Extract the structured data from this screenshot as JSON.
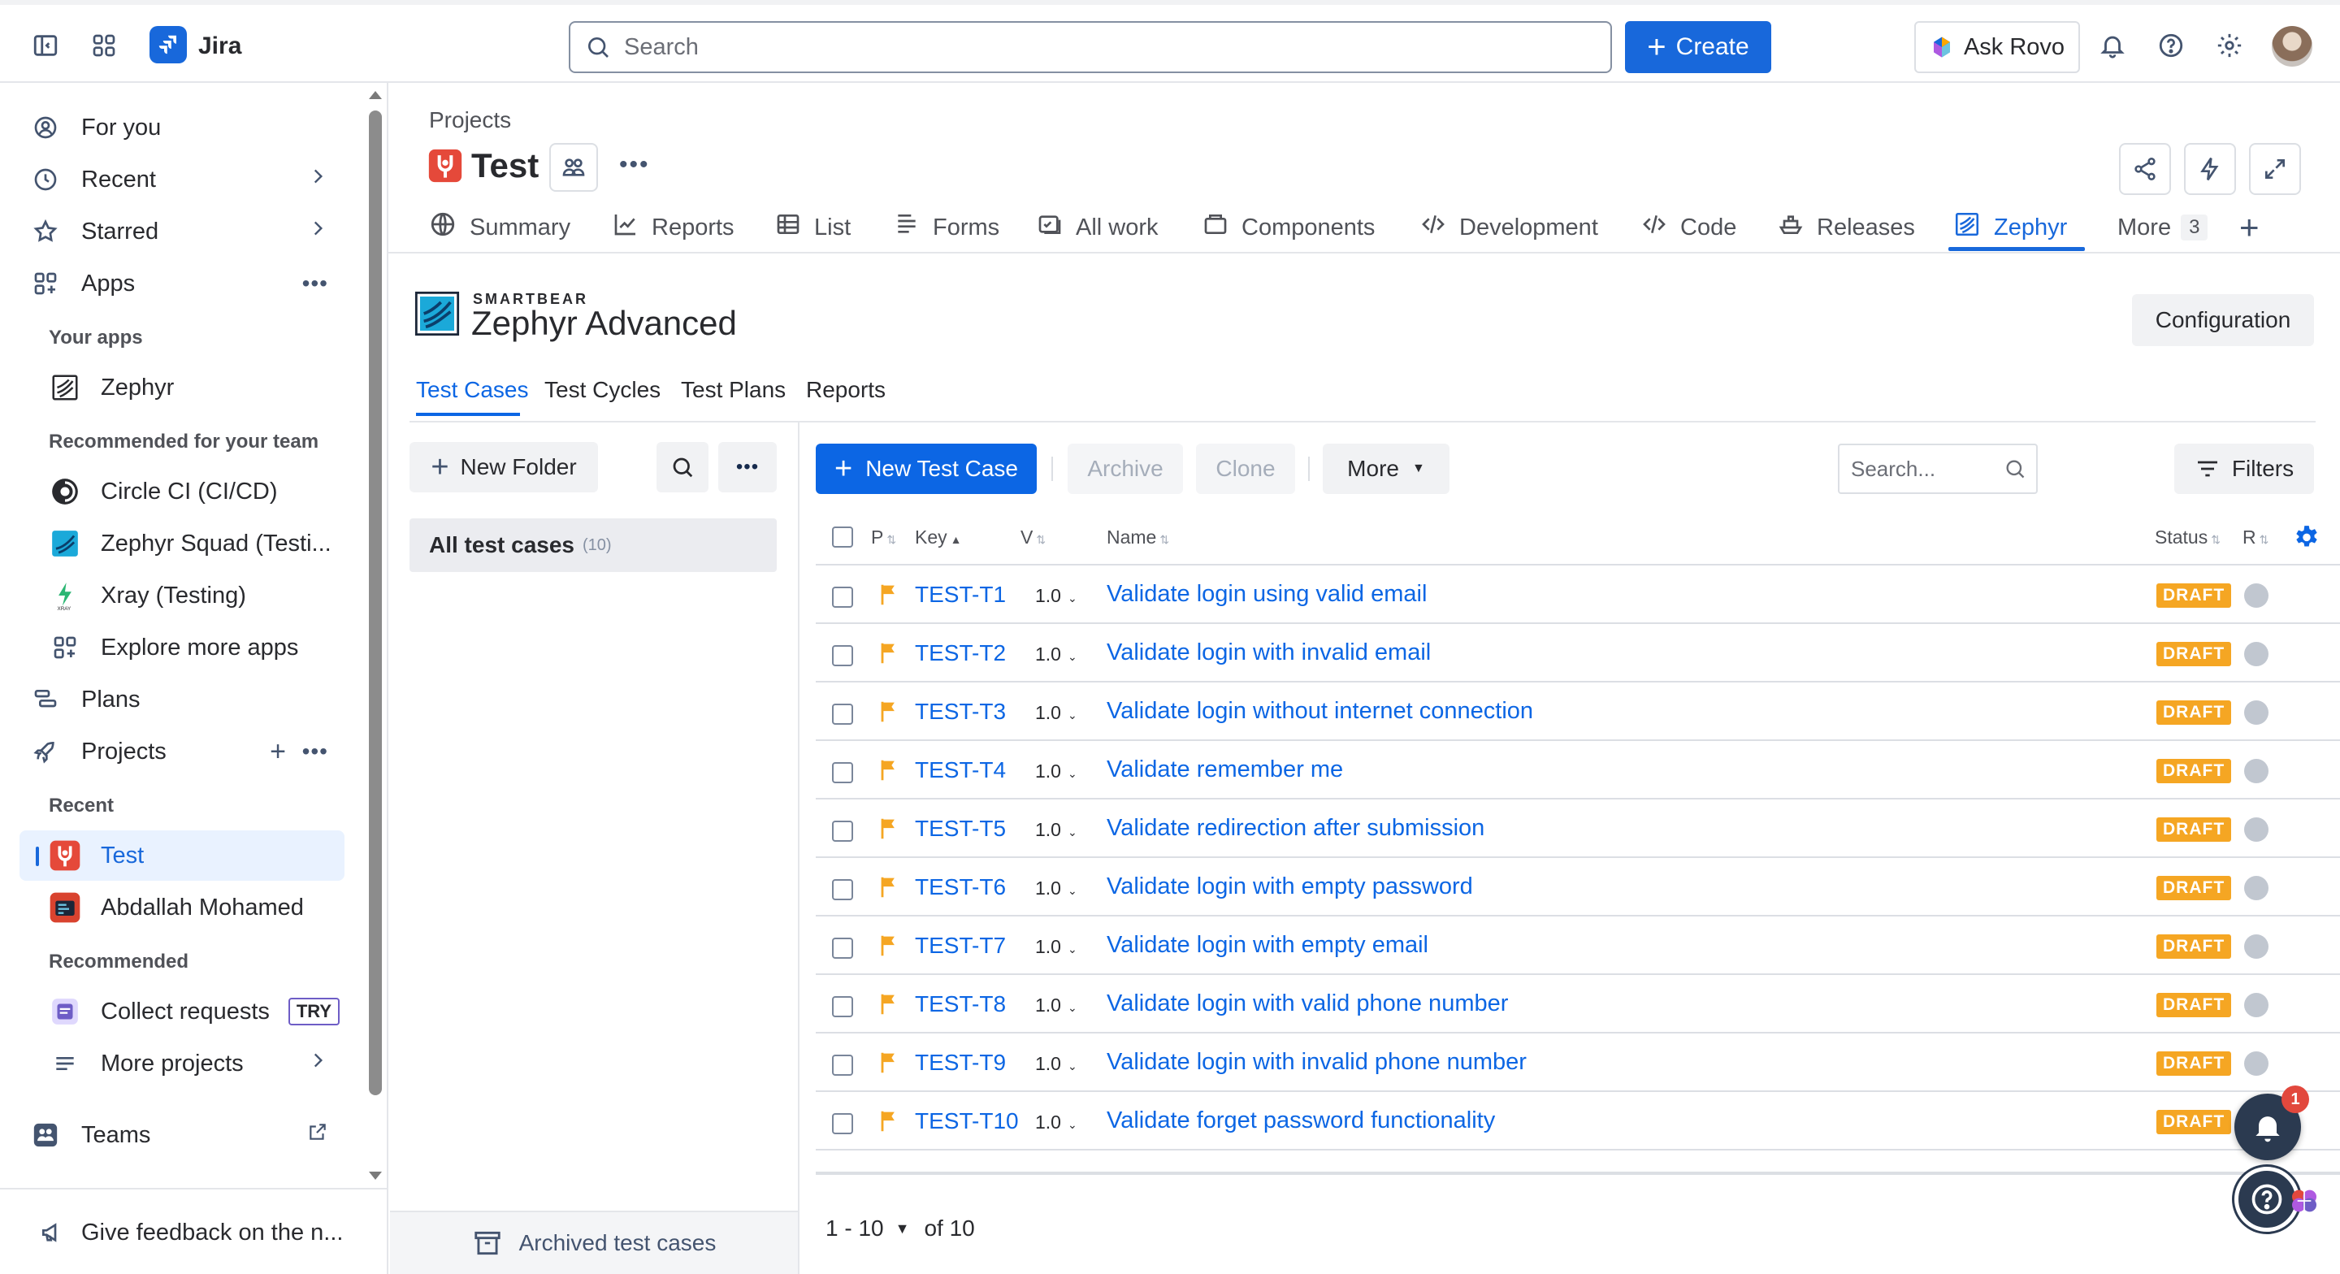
{
  "app": {
    "name": "Jira"
  },
  "topbar": {
    "search_placeholder": "Search",
    "create_label": "Create",
    "ask_rovo_label": "Ask Rovo"
  },
  "sidebar": {
    "for_you": "For you",
    "recent": "Recent",
    "starred": "Starred",
    "apps": "Apps",
    "your_apps_heading": "Your apps",
    "zephyr": "Zephyr",
    "recommended_team_heading": "Recommended for your team",
    "circle_ci": "Circle CI (CI/CD)",
    "zephyr_squad": "Zephyr Squad (Testi...",
    "xray": "Xray (Testing)",
    "explore_apps": "Explore more apps",
    "plans": "Plans",
    "projects": "Projects",
    "recent_heading": "Recent",
    "project_test": "Test",
    "project_abdallah": "Abdallah Mohamed",
    "recommended_heading": "Recommended",
    "collect_requests": "Collect requests",
    "try_badge": "TRY",
    "more_projects": "More projects",
    "teams": "Teams",
    "feedback": "Give feedback on the n..."
  },
  "project": {
    "breadcrumb": "Projects",
    "title": "Test",
    "tabs": [
      {
        "label": "Summary"
      },
      {
        "label": "Reports"
      },
      {
        "label": "List"
      },
      {
        "label": "Forms"
      },
      {
        "label": "All work"
      },
      {
        "label": "Components"
      },
      {
        "label": "Development"
      },
      {
        "label": "Code"
      },
      {
        "label": "Releases"
      },
      {
        "label": "Zephyr"
      },
      {
        "label": "More",
        "count": "3"
      }
    ]
  },
  "zephyr": {
    "brand_small": "SMARTBEAR",
    "brand_name": "Zephyr Advanced",
    "configuration_label": "Configuration",
    "subtabs": [
      "Test Cases",
      "Test Cycles",
      "Test Plans",
      "Reports"
    ],
    "new_folder_label": "New Folder",
    "all_test_cases_label": "All test cases",
    "all_test_cases_count": "(10)",
    "archived_label": "Archived test cases",
    "new_test_case_label": "New Test Case",
    "archive_label": "Archive",
    "clone_label": "Clone",
    "more_label": "More",
    "search_placeholder": "Search...",
    "filters_label": "Filters",
    "columns": {
      "p": "P",
      "key": "Key",
      "v": "V",
      "name": "Name",
      "status": "Status",
      "r": "R"
    },
    "rows": [
      {
        "key": "TEST-T1",
        "version": "1.0",
        "name": "Validate login using valid email",
        "status": "DRAFT"
      },
      {
        "key": "TEST-T2",
        "version": "1.0",
        "name": "Validate login with invalid email",
        "status": "DRAFT"
      },
      {
        "key": "TEST-T3",
        "version": "1.0",
        "name": "Validate login without internet connection",
        "status": "DRAFT"
      },
      {
        "key": "TEST-T4",
        "version": "1.0",
        "name": "Validate remember me",
        "status": "DRAFT"
      },
      {
        "key": "TEST-T5",
        "version": "1.0",
        "name": "Validate redirection after submission",
        "status": "DRAFT"
      },
      {
        "key": "TEST-T6",
        "version": "1.0",
        "name": "Validate login with empty password",
        "status": "DRAFT"
      },
      {
        "key": "TEST-T7",
        "version": "1.0",
        "name": "Validate login with empty email",
        "status": "DRAFT"
      },
      {
        "key": "TEST-T8",
        "version": "1.0",
        "name": "Validate login with valid phone number",
        "status": "DRAFT"
      },
      {
        "key": "TEST-T9",
        "version": "1.0",
        "name": "Validate login with invalid phone number",
        "status": "DRAFT"
      },
      {
        "key": "TEST-T10",
        "version": "1.0",
        "name": "Validate forget password functionality",
        "status": "DRAFT"
      }
    ],
    "pagination_range": "1 - 10",
    "pagination_total": "of 10",
    "notification_count": "1"
  },
  "colors": {
    "accent": "#0C66E4",
    "draft": "#F5A623",
    "selected_bg": "#E9F2FF"
  }
}
